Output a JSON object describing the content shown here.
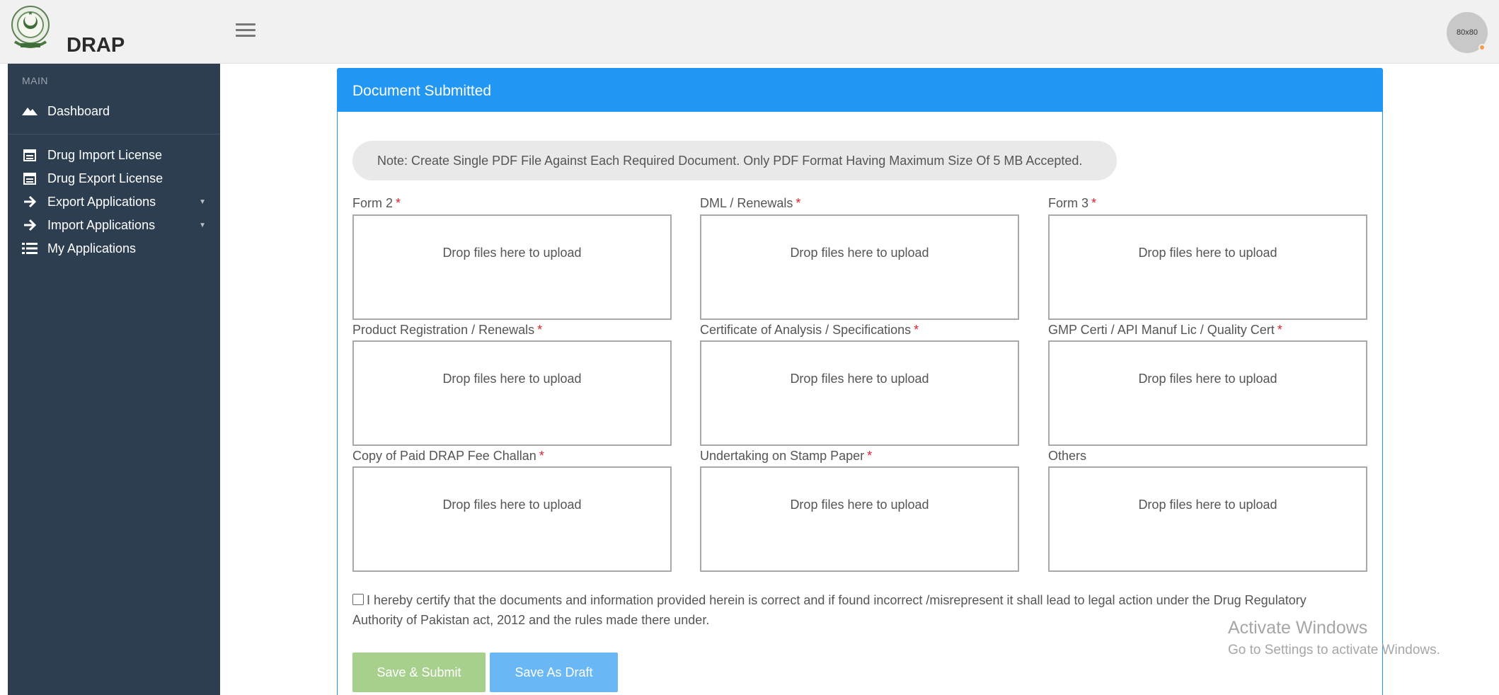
{
  "header": {
    "brand": "DRAP",
    "avatar_text": "80x80"
  },
  "sidebar": {
    "section_label": "MAIN",
    "items": [
      {
        "label": "Dashboard",
        "icon": "mountain-icon"
      },
      {
        "label": "Drug Import License",
        "icon": "calendar-icon"
      },
      {
        "label": "Drug Export License",
        "icon": "calendar-icon"
      },
      {
        "label": "Export Applications",
        "icon": "arrow-right-icon"
      },
      {
        "label": "Import Applications",
        "icon": "arrow-right-icon"
      },
      {
        "label": "My Applications",
        "icon": "list-icon"
      }
    ]
  },
  "panel": {
    "title": "Document Submitted",
    "note": "Note: Create Single PDF File Against Each Required Document. Only PDF Format Having Maximum Size Of 5 MB Accepted.",
    "dropzone_text": "Drop files here to upload",
    "required_mark": "*",
    "fields": [
      {
        "label": "Form 2",
        "required": true
      },
      {
        "label": "DML / Renewals",
        "required": true
      },
      {
        "label": "Form 3",
        "required": true
      },
      {
        "label": "Product Registration / Renewals",
        "required": true
      },
      {
        "label": "Certificate of Analysis / Specifications",
        "required": true
      },
      {
        "label": "GMP Certi / API Manuf Lic / Quality Cert",
        "required": true
      },
      {
        "label": "Copy of Paid DRAP Fee Challan",
        "required": true
      },
      {
        "label": "Undertaking on Stamp Paper",
        "required": true
      },
      {
        "label": "Others",
        "required": false
      }
    ],
    "certify_text": "I hereby certify that the documents and information provided herein is correct and if found incorrect /misrepresent it shall lead to legal action under the Drug Regulatory Authority of Pakistan act, 2012 and the rules made there under.",
    "certify_checked": false,
    "save_submit_label": "Save & Submit",
    "save_draft_label": "Save As Draft"
  },
  "watermark": {
    "line1": "Activate Windows",
    "line2": "Go to Settings to activate Windows."
  },
  "colors": {
    "accent": "#2196f3",
    "sidebar": "#2c3e50",
    "submit": "#a8d08d",
    "draft": "#6ab7f5",
    "required": "#e0202a"
  }
}
